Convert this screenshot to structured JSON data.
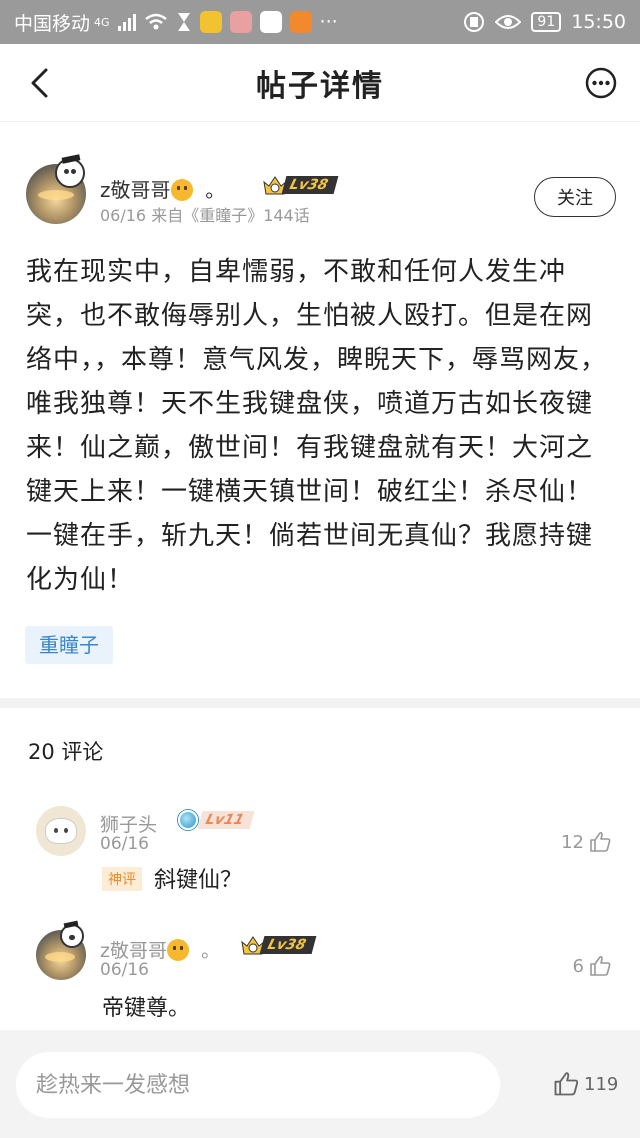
{
  "status_bar": {
    "carrier": "中国移动",
    "network": "4G",
    "battery": "91",
    "time": "15:50"
  },
  "nav": {
    "title": "帖子详情"
  },
  "post": {
    "author": "z敬哥哥",
    "author_suffix": "。",
    "level": "Lv38",
    "meta": "06/16 来自《重瞳子》144话",
    "follow_label": "关注",
    "content": "我在现实中，自卑懦弱，不敢和任何人发生冲突，也不敢侮辱别人，生怕被人殴打。但是在网络中，，本尊！意气风发，睥睨天下，辱骂网友，唯我独尊！天不生我键盘侠，喷道万古如长夜键来！仙之巅，傲世间！有我键盘就有天！大河之键天上来！一键横天镇世间！破红尘！杀尽仙！一键在手，斩九天！倘若世间无真仙？我愿持键化为仙！",
    "tag": "重瞳子"
  },
  "comments": {
    "header": "20 评论",
    "items": [
      {
        "name": "狮子头",
        "level": "Lv11",
        "date": "06/16",
        "badge": "神评",
        "text": "斜键仙？",
        "likes": "12"
      },
      {
        "name": "z敬哥哥",
        "name_suffix": "。",
        "level": "Lv38",
        "date": "06/16",
        "text": "帝键尊。",
        "likes": "6"
      }
    ]
  },
  "bottom_bar": {
    "input_placeholder": "趁热来一发感想",
    "likes": "119"
  }
}
